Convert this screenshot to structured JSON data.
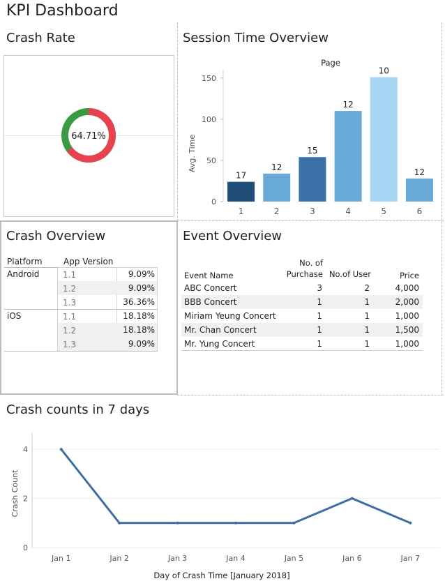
{
  "dashboard": {
    "title": "KPI Dashboard"
  },
  "crash_rate": {
    "title": "Crash Rate",
    "value_label": "64.71%",
    "value_pct": 64.71,
    "colors": {
      "crash": "#e8414f",
      "ok": "#3a9a3f"
    }
  },
  "session": {
    "title": "Session Time Overview",
    "chart_header": "Page",
    "ylabel": "Avg. Time"
  },
  "crash_overview": {
    "title": "Crash Overview",
    "headers": {
      "platform": "Platform",
      "version": "App Version"
    },
    "groups": [
      {
        "platform": "Android",
        "rows": [
          {
            "version": "1.1",
            "value": "9.09%"
          },
          {
            "version": "1.2",
            "value": "9.09%"
          },
          {
            "version": "1.3",
            "value": "36.36%"
          }
        ]
      },
      {
        "platform": "iOS",
        "rows": [
          {
            "version": "1.1",
            "value": "18.18%"
          },
          {
            "version": "1.2",
            "value": "18.18%"
          },
          {
            "version": "1.3",
            "value": "9.09%"
          }
        ]
      }
    ]
  },
  "event_overview": {
    "title": "Event Overview",
    "headers": {
      "name": "Event Name",
      "purchase_1": "No. of",
      "purchase_2": "Purchase",
      "users": "No.of User",
      "price": "Price"
    },
    "rows": [
      {
        "name": "ABC Concert",
        "purchase": "3",
        "users": "2",
        "price": "4,000"
      },
      {
        "name": "BBB Concert",
        "purchase": "1",
        "users": "1",
        "price": "2,000"
      },
      {
        "name": "Miriam Yeung Concert",
        "purchase": "1",
        "users": "1",
        "price": "1,000"
      },
      {
        "name": "Mr. Chan Concert",
        "purchase": "1",
        "users": "1",
        "price": "1,500"
      },
      {
        "name": "Mr. Yung Concert",
        "purchase": "1",
        "users": "1",
        "price": "1,000"
      }
    ]
  },
  "crash_counts": {
    "title": "Crash counts in 7 days"
  },
  "chart_data": [
    {
      "type": "pie",
      "title": "",
      "slices": [
        {
          "label": "crash",
          "value": 64.71,
          "color": "#e8414f"
        },
        {
          "label": "ok",
          "value": 35.29,
          "color": "#3a9a3f"
        }
      ],
      "center_label": "64.71%"
    },
    {
      "type": "bar",
      "title": "Page",
      "categories": [
        "1",
        "2",
        "3",
        "4",
        "5",
        "6"
      ],
      "values": [
        24,
        34,
        54,
        110,
        151,
        28
      ],
      "data_labels": [
        "17",
        "12",
        "15",
        "12",
        "10",
        "12"
      ],
      "colors": [
        "#1f4e79",
        "#6aaad8",
        "#3a72a7",
        "#6aaad8",
        "#a9d6f5",
        "#6aaad8"
      ],
      "xlabel": "",
      "ylabel": "Avg. Time",
      "ylim": [
        0,
        160
      ],
      "yticks": [
        0,
        50,
        100,
        150
      ]
    },
    {
      "type": "line",
      "title": "",
      "x": [
        "Jan 1",
        "Jan 2",
        "Jan 3",
        "Jan 4",
        "Jan 5",
        "Jan 6",
        "Jan 7"
      ],
      "y": [
        4,
        1,
        1,
        1,
        1,
        2,
        1
      ],
      "xlabel": "Day of Crash Time [January 2018]",
      "ylabel": "Crash Count",
      "ylim": [
        0,
        4.4
      ],
      "yticks": [
        0,
        2,
        4
      ],
      "color": "#3e6ea1",
      "grid": true
    }
  ]
}
